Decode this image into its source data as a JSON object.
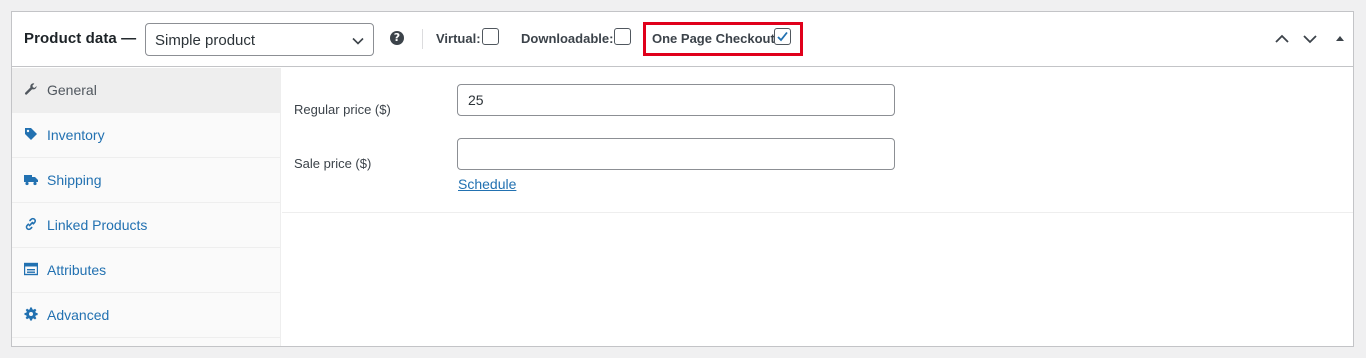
{
  "header": {
    "title": "Product data —",
    "product_type": {
      "selected": "Simple product",
      "icon": "chevron-down-icon"
    },
    "help_icon": "help-icon",
    "options": {
      "virtual": {
        "label": "Virtual:",
        "checked": false
      },
      "downloadable": {
        "label": "Downloadable:",
        "checked": false
      },
      "one_page_checkout": {
        "label": "One Page Checkout:",
        "checked": true
      }
    },
    "highlight_color": "#e0001b"
  },
  "tabs": [
    {
      "label": "General",
      "icon": "wrench-icon",
      "active": true
    },
    {
      "label": "Inventory",
      "icon": "tag-icon",
      "active": false
    },
    {
      "label": "Shipping",
      "icon": "truck-icon",
      "active": false
    },
    {
      "label": "Linked Products",
      "icon": "link-icon",
      "active": false
    },
    {
      "label": "Attributes",
      "icon": "list-icon",
      "active": false
    },
    {
      "label": "Advanced",
      "icon": "gear-icon",
      "active": false
    }
  ],
  "general": {
    "regular_price": {
      "label": "Regular price ($)",
      "value": "25"
    },
    "sale_price": {
      "label": "Sale price ($)",
      "value": ""
    },
    "schedule_link": "Schedule"
  },
  "colors": {
    "link": "#2271b1",
    "border": "#c3c4c7",
    "active_tab": "#eeeeee"
  }
}
